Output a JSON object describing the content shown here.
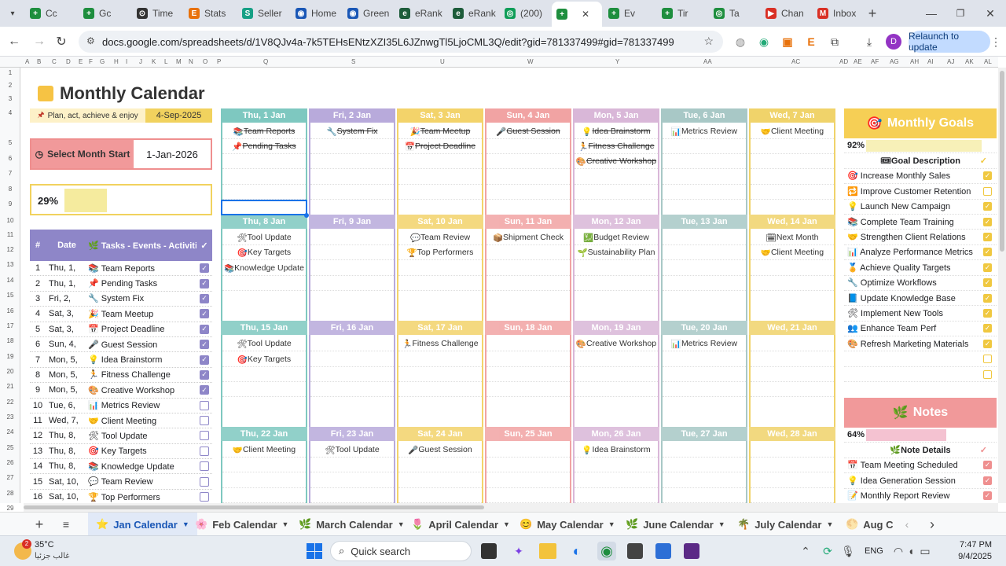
{
  "browser": {
    "tabs": [
      {
        "label": "Cc",
        "color": "#1e8e3e",
        "glyph": "+"
      },
      {
        "label": "Gc",
        "color": "#1e8e3e",
        "glyph": "+"
      },
      {
        "label": "Time",
        "color": "#333333",
        "glyph": "⊙"
      },
      {
        "label": "Stats",
        "color": "#e8710a",
        "glyph": "E"
      },
      {
        "label": "Seller",
        "color": "#16a085",
        "glyph": "S"
      },
      {
        "label": "Home",
        "color": "#1a57b6",
        "glyph": "◉"
      },
      {
        "label": "Green",
        "color": "#1a57b6",
        "glyph": "◉"
      },
      {
        "label": "eRank",
        "color": "#1d5c3a",
        "glyph": "e"
      },
      {
        "label": "eRank",
        "color": "#1d5c3a",
        "glyph": "e"
      },
      {
        "label": "(200)",
        "color": "#0f9d58",
        "glyph": "◎"
      },
      {
        "label": "",
        "color": "#1e8e3e",
        "glyph": "+"
      },
      {
        "label": "Ev",
        "color": "#1e8e3e",
        "glyph": "+"
      },
      {
        "label": "Tir",
        "color": "#1e8e3e",
        "glyph": "+"
      },
      {
        "label": "Ta",
        "color": "#1e8e3e",
        "glyph": "◎"
      },
      {
        "label": "Chan",
        "color": "#d93025",
        "glyph": "▶"
      },
      {
        "label": "Inbox",
        "color": "#d93025",
        "glyph": "M"
      }
    ],
    "url": "docs.google.com/spreadsheets/d/1V8QJv4a-7k5TEHsENtzXZI35L6JZnwgTl5LjoCML3Q/edit?gid=781337499#gid=781337499",
    "relaunch_label": "Relaunch to update",
    "profile_initial": "D"
  },
  "sheet": {
    "col_letters": [
      "A",
      "B",
      "C",
      "D",
      "E",
      "F",
      "G",
      "H",
      "I",
      "J",
      "K",
      "L",
      "M",
      "N",
      "O",
      "P",
      "Q",
      "S",
      "U",
      "W",
      "Y",
      "AA",
      "AC",
      "AD",
      "AE",
      "AF",
      "AG",
      "AH",
      "AI",
      "AJ",
      "AK",
      "AL"
    ],
    "row_numbers": [
      "1",
      "2",
      "3",
      "4",
      "5",
      "6",
      "7",
      "8",
      "9",
      "10",
      "11",
      "12",
      "13",
      "14",
      "15",
      "16",
      "17",
      "18",
      "19",
      "20",
      "21",
      "22",
      "23",
      "24",
      "25",
      "26",
      "27",
      "28",
      "29"
    ],
    "title": "Monthly Calendar",
    "tagline": "Plan, act, achieve & enjoy",
    "tag_date": "4-Sep-2025",
    "select_label": "Select Month Start",
    "select_value": "1-Jan-2026",
    "progress_text": "29%",
    "progress_value": 0.29,
    "task_header": {
      "num": "#",
      "date": "Date",
      "tasks": "Tasks - Events - Activities",
      "check": "✓"
    },
    "tasks": [
      {
        "n": "1",
        "d": "Thu, 1,",
        "t": "Team Reports",
        "i": "📚",
        "done": true
      },
      {
        "n": "2",
        "d": "Thu, 1,",
        "t": "Pending Tasks",
        "i": "📌",
        "done": true
      },
      {
        "n": "3",
        "d": "Fri, 2,",
        "t": "System Fix",
        "i": "🔧",
        "done": true
      },
      {
        "n": "4",
        "d": "Sat, 3,",
        "t": "Team Meetup",
        "i": "🎉",
        "done": true
      },
      {
        "n": "5",
        "d": "Sat, 3,",
        "t": "Project Deadline",
        "i": "📅",
        "done": true
      },
      {
        "n": "6",
        "d": "Sun, 4,",
        "t": "Guest Session",
        "i": "🎤",
        "done": true
      },
      {
        "n": "7",
        "d": "Mon, 5,",
        "t": "Idea Brainstorm",
        "i": "💡",
        "done": true
      },
      {
        "n": "8",
        "d": "Mon, 5,",
        "t": "Fitness Challenge",
        "i": "🏃",
        "done": true
      },
      {
        "n": "9",
        "d": "Mon, 5,",
        "t": "Creative Workshop",
        "i": "🎨",
        "done": true
      },
      {
        "n": "10",
        "d": "Tue, 6,",
        "t": "Metrics Review",
        "i": "📊",
        "done": false
      },
      {
        "n": "11",
        "d": "Wed, 7,",
        "t": "Client Meeting",
        "i": "🤝",
        "done": false
      },
      {
        "n": "12",
        "d": "Thu, 8,",
        "t": "Tool Update",
        "i": "🛠",
        "done": false
      },
      {
        "n": "13",
        "d": "Thu, 8,",
        "t": "Key Targets",
        "i": "🎯",
        "done": false
      },
      {
        "n": "14",
        "d": "Thu, 8,",
        "t": "Knowledge Update",
        "i": "📚",
        "done": false
      },
      {
        "n": "15",
        "d": "Sat, 10,",
        "t": "Team Review",
        "i": "💬",
        "done": false
      },
      {
        "n": "16",
        "d": "Sat, 10,",
        "t": "Top Performers",
        "i": "🏆",
        "done": false
      }
    ],
    "weeks": [
      {
        "days": [
          {
            "h": "Thu, 1 Jan",
            "items": [
              {
                "t": "Team Reports",
                "i": "📚",
                "s": true
              },
              {
                "t": "Pending Tasks",
                "i": "📌",
                "s": true
              }
            ]
          },
          {
            "h": "Fri, 2 Jan",
            "items": [
              {
                "t": "System Fix",
                "i": "🔧",
                "s": true
              }
            ]
          },
          {
            "h": "Sat, 3 Jan",
            "items": [
              {
                "t": "Team Meetup",
                "i": "🎉",
                "s": true
              },
              {
                "t": "Project Deadline",
                "i": "📅",
                "s": true
              }
            ]
          },
          {
            "h": "Sun, 4 Jan",
            "items": [
              {
                "t": "Guest Session",
                "i": "🎤",
                "s": true
              }
            ]
          },
          {
            "h": "Mon, 5 Jan",
            "items": [
              {
                "t": "Idea Brainstorm",
                "i": "💡",
                "s": true
              },
              {
                "t": "Fitness Challenge",
                "i": "🏃",
                "s": true
              },
              {
                "t": "Creative Workshop",
                "i": "🎨",
                "s": true
              }
            ]
          },
          {
            "h": "Tue, 6 Jan",
            "items": [
              {
                "t": "Metrics Review",
                "i": "📊",
                "s": false
              }
            ]
          },
          {
            "h": "Wed, 7 Jan",
            "items": [
              {
                "t": "Client Meeting",
                "i": "🤝",
                "s": false
              }
            ]
          }
        ]
      },
      {
        "days": [
          {
            "h": "Thu, 8 Jan",
            "items": [
              {
                "t": "Tool Update",
                "i": "🛠",
                "s": false
              },
              {
                "t": "Key Targets",
                "i": "🎯",
                "s": false
              },
              {
                "t": "Knowledge Update",
                "i": "📚",
                "s": false
              }
            ]
          },
          {
            "h": "Fri, 9 Jan",
            "items": []
          },
          {
            "h": "Sat, 10 Jan",
            "items": [
              {
                "t": "Team Review",
                "i": "💬",
                "s": false
              },
              {
                "t": "Top Performers",
                "i": "🏆",
                "s": false
              }
            ]
          },
          {
            "h": "Sun, 11 Jan",
            "items": [
              {
                "t": "Shipment Check",
                "i": "📦",
                "s": false
              }
            ]
          },
          {
            "h": "Mon, 12 Jan",
            "items": [
              {
                "t": "Budget Review",
                "i": "💹",
                "s": false
              },
              {
                "t": "Sustainability Plan",
                "i": "🌱",
                "s": false
              }
            ]
          },
          {
            "h": "Tue, 13 Jan",
            "items": []
          },
          {
            "h": "Wed, 14 Jan",
            "items": [
              {
                "t": "Next Month",
                "i": "🗓",
                "s": false
              },
              {
                "t": "Client Meeting",
                "i": "🤝",
                "s": false
              }
            ]
          }
        ]
      },
      {
        "days": [
          {
            "h": "Thu, 15 Jan",
            "items": [
              {
                "t": "Tool Update",
                "i": "🛠",
                "s": false
              },
              {
                "t": "Key Targets",
                "i": "🎯",
                "s": false
              }
            ]
          },
          {
            "h": "Fri, 16 Jan",
            "items": []
          },
          {
            "h": "Sat, 17 Jan",
            "items": [
              {
                "t": "Fitness Challenge",
                "i": "🏃",
                "s": false
              }
            ]
          },
          {
            "h": "Sun, 18 Jan",
            "items": []
          },
          {
            "h": "Mon, 19 Jan",
            "items": [
              {
                "t": "Creative Workshop",
                "i": "🎨",
                "s": false
              }
            ]
          },
          {
            "h": "Tue, 20 Jan",
            "items": [
              {
                "t": "Metrics Review",
                "i": "📊",
                "s": false
              }
            ]
          },
          {
            "h": "Wed, 21 Jan",
            "items": []
          }
        ]
      },
      {
        "days": [
          {
            "h": "Thu, 22 Jan",
            "items": [
              {
                "t": "Client Meeting",
                "i": "🤝",
                "s": false
              }
            ]
          },
          {
            "h": "Fri, 23 Jan",
            "items": [
              {
                "t": "Tool Update",
                "i": "🛠",
                "s": false
              }
            ]
          },
          {
            "h": "Sat, 24 Jan",
            "items": [
              {
                "t": "Guest Session",
                "i": "🎤",
                "s": false
              }
            ]
          },
          {
            "h": "Sun, 25 Jan",
            "items": []
          },
          {
            "h": "Mon, 26 Jan",
            "items": [
              {
                "t": "Idea Brainstorm",
                "i": "💡",
                "s": false
              }
            ]
          },
          {
            "h": "Tue, 27 Jan",
            "items": []
          },
          {
            "h": "Wed, 28 Jan",
            "items": []
          }
        ]
      }
    ],
    "day_colors": [
      "#7ec8c0",
      "#b8aadb",
      "#f3d36a",
      "#f1a3a3",
      "#d9b7d8",
      "#a8c8c6",
      "#f0d36a"
    ],
    "goals": {
      "title": "Monthly Goals",
      "pct": "92%",
      "pct_value": 0.92,
      "desc_header": "Goal Description",
      "items": [
        {
          "t": "Increase Monthly Sales",
          "i": "🎯",
          "done": true
        },
        {
          "t": "Improve Customer Retention",
          "i": "🔁",
          "done": false
        },
        {
          "t": "Launch New Campaign",
          "i": "💡",
          "done": true
        },
        {
          "t": "Complete Team Training",
          "i": "📚",
          "done": true
        },
        {
          "t": "Strengthen Client Relations",
          "i": "🤝",
          "done": true
        },
        {
          "t": "Analyze Performance Metrics",
          "i": "📊",
          "done": true
        },
        {
          "t": "Achieve Quality Targets",
          "i": "🏅",
          "done": true
        },
        {
          "t": "Optimize Workflows",
          "i": "🔧",
          "done": true
        },
        {
          "t": "Update Knowledge Base",
          "i": "📘",
          "done": true
        },
        {
          "t": "Implement New Tools",
          "i": "🛠",
          "done": true
        },
        {
          "t": "Enhance Team Perf",
          "i": "👥",
          "done": true
        },
        {
          "t": "Refresh Marketing Materials",
          "i": "🎨",
          "done": true
        },
        {
          "t": "",
          "i": "",
          "done": false
        },
        {
          "t": "",
          "i": "",
          "done": false
        }
      ]
    },
    "notes": {
      "title": "Notes",
      "pct": "64%",
      "pct_value": 0.64,
      "header": "Note Details",
      "items": [
        {
          "t": "Team Meeting Scheduled",
          "i": "📅",
          "done": true
        },
        {
          "t": "Idea Generation Session",
          "i": "💡",
          "done": true
        },
        {
          "t": "Monthly Report Review",
          "i": "📝",
          "done": true
        }
      ]
    }
  },
  "sheet_tabs": [
    {
      "label": "Jan Calendar",
      "i": "⭐",
      "active": true
    },
    {
      "label": "Feb Calendar",
      "i": "🌸",
      "active": false
    },
    {
      "label": "March Calendar",
      "i": "🌿",
      "active": false
    },
    {
      "label": "April Calendar",
      "i": "🌷",
      "active": false
    },
    {
      "label": "May Calendar",
      "i": "😊",
      "active": false
    },
    {
      "label": "June Calendar",
      "i": "🌿",
      "active": false
    },
    {
      "label": "July Calendar",
      "i": "🌴",
      "active": false
    },
    {
      "label": "Aug C",
      "i": "🌕",
      "active": false
    }
  ],
  "taskbar": {
    "weather_temp": "35°C",
    "weather_desc": "غالب جزئيا",
    "weather_badge": "2",
    "search_placeholder": "Quick search",
    "lang": "ENG",
    "time": "7:47 PM",
    "date": "9/4/2025"
  }
}
